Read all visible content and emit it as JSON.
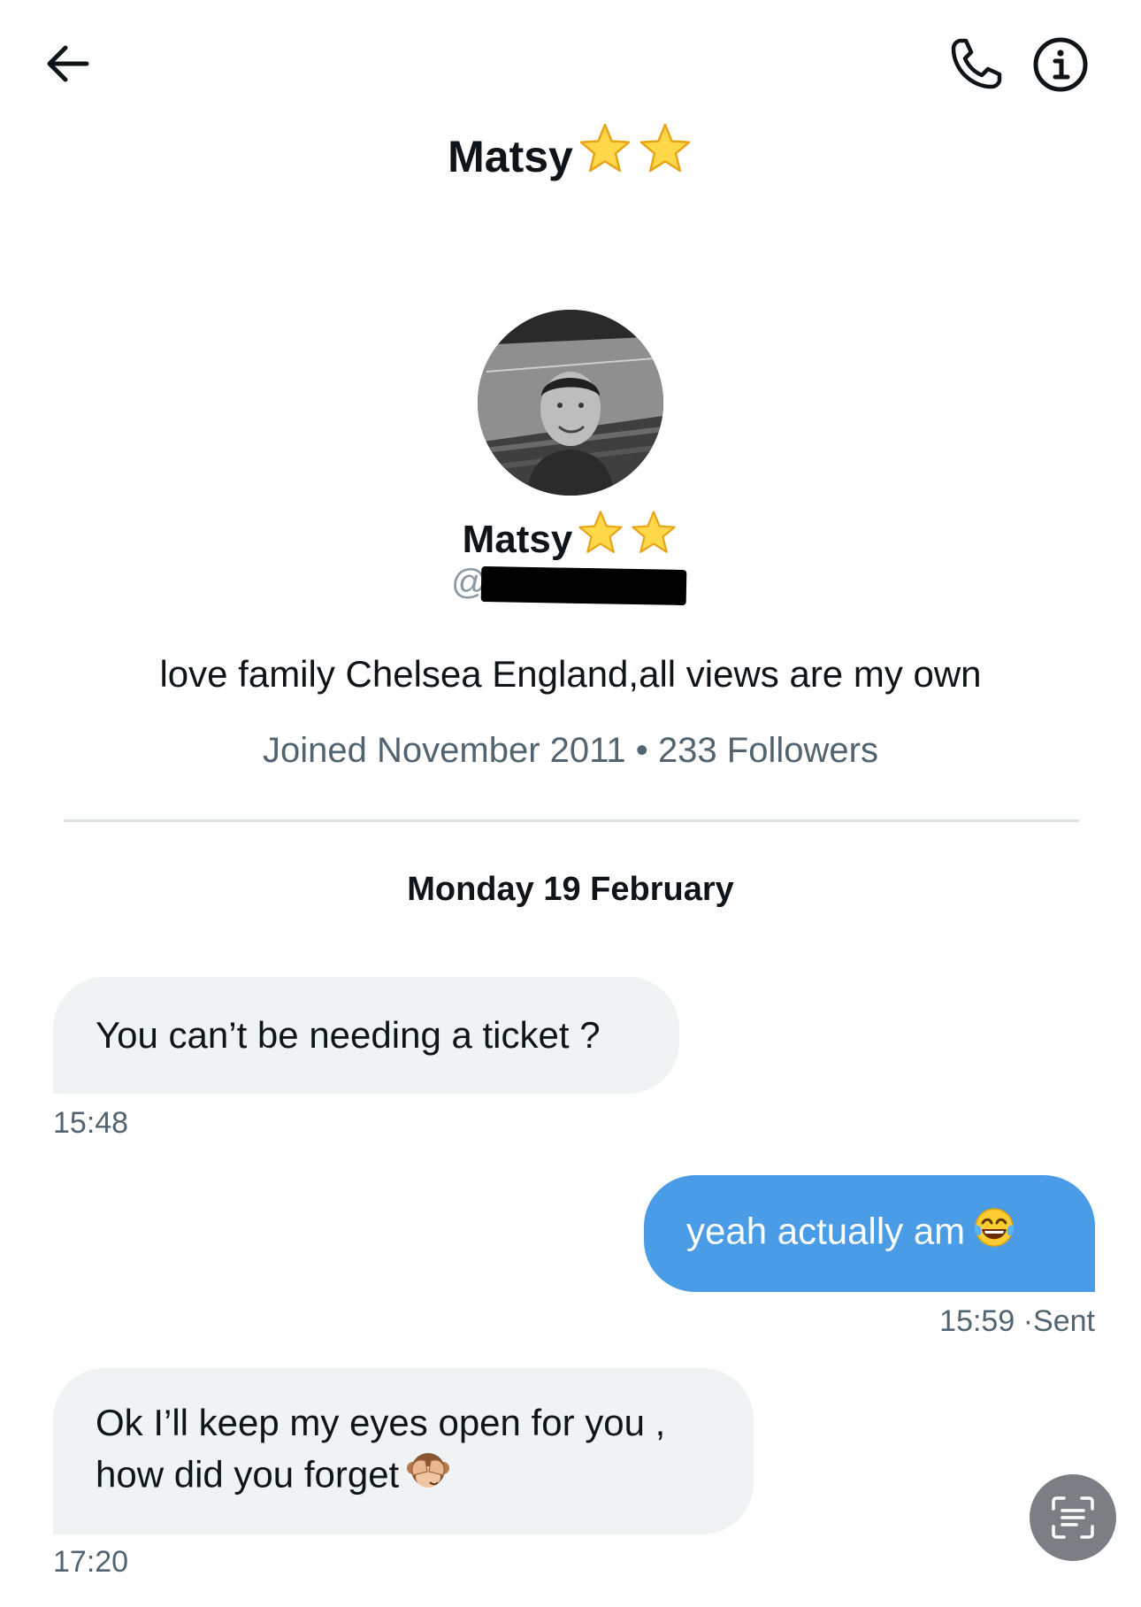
{
  "header": {
    "title": "Matsy",
    "back_icon": "arrow-left-icon",
    "call_icon": "phone-icon",
    "info_icon": "info-icon"
  },
  "profile": {
    "name": "Matsy",
    "handle_prefix": "@",
    "bio": "love family Chelsea England,all views are my own",
    "joined": "Joined November 2011",
    "followers": "233 Followers",
    "separator": "•"
  },
  "conversation": {
    "date": "Monday 19 February",
    "messages": [
      {
        "direction": "incoming",
        "text": "You can’t be needing a ticket ?",
        "time": "15:48"
      },
      {
        "direction": "outgoing",
        "text": "yeah actually am",
        "emoji": "face-with-tears-of-joy",
        "time": "15:59",
        "status": "Sent"
      },
      {
        "direction": "incoming",
        "line1": "Ok I’ll keep my eyes open for you ,",
        "line2": "how did you forget",
        "emoji": "see-no-evil-monkey",
        "time": "17:20"
      }
    ]
  },
  "fab": {
    "icon": "scan-text-icon"
  },
  "colors": {
    "outgoing_bubble": "#4a9ce7",
    "incoming_bubble": "#eff3f4",
    "secondary_text": "#536471"
  }
}
